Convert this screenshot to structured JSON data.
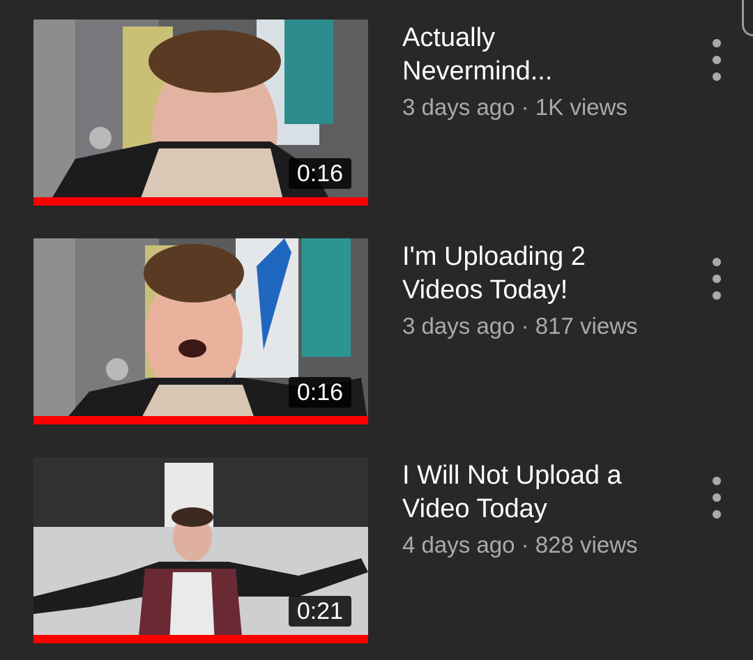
{
  "videos": [
    {
      "title_line1": "Actually",
      "title_line2": "Nevermind...",
      "age": "3 days ago",
      "views": "1K views",
      "duration": "0:16"
    },
    {
      "title_line1": "I'm Uploading 2",
      "title_line2": "Videos Today!",
      "age": "3 days ago",
      "views": "817 views",
      "duration": "0:16"
    },
    {
      "title_line1": "I Will Not Upload a",
      "title_line2": "Video Today",
      "age": "4 days ago",
      "views": "828 views",
      "duration": "0:21"
    }
  ],
  "separator": " · ",
  "menu_icon": "more-vert-icon",
  "colors": {
    "background": "#282828",
    "progress": "#ff0000",
    "title": "#ffffff",
    "subtitle": "#aaaaaa"
  }
}
